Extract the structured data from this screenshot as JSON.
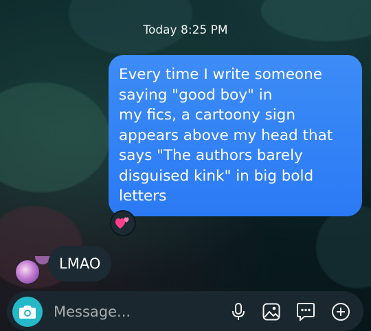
{
  "thread": {
    "timestamp": "Today 8:25 PM",
    "outgoing_lines": [
      "Every time I write someone",
      "saying \"good boy\" in",
      "my fics, a cartoony sign",
      "appears above my head that",
      "says \"The authors barely",
      "disguised kink\" in big bold",
      "letters"
    ],
    "reaction": "heart-eyes-reaction",
    "incoming_text": "LMAO"
  },
  "composer": {
    "placeholder": "Message..."
  },
  "icons": {
    "camera": "camera-icon",
    "mic": "microphone-icon",
    "gallery": "image-icon",
    "sticker": "chat-bubble-icon",
    "more": "plus-circle-icon"
  },
  "colors": {
    "outgoing_bubble": "#3d8cf7",
    "incoming_bubble": "#1b2a33",
    "camera_button": "#24b8c9"
  }
}
